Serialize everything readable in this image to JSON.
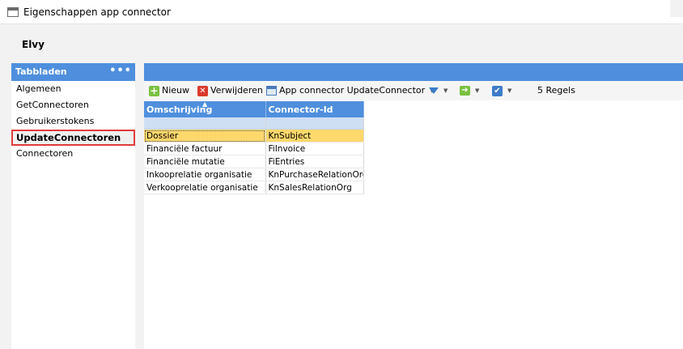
{
  "window": {
    "title": "Eigenschappen app connector"
  },
  "organization": "Elvy",
  "sidebar": {
    "header": "Tabbladen",
    "more": "•••",
    "items": [
      {
        "label": "Algemeen"
      },
      {
        "label": "GetConnectoren"
      },
      {
        "label": "Gebruikerstokens"
      },
      {
        "label": "UpdateConnectoren",
        "selected": true
      },
      {
        "label": "Connectoren"
      }
    ]
  },
  "toolbar": {
    "new_label": "Nieuw",
    "delete_label": "Verwijderen",
    "connector_label": "App connector UpdateConnector",
    "count_label": "5 Regels"
  },
  "grid": {
    "columns": [
      "Omschrijving",
      "Connector-Id"
    ],
    "rows": [
      {
        "description": "Dossier",
        "connector_id": "KnSubject",
        "selected": true
      },
      {
        "description": "Financiële factuur",
        "connector_id": "FiInvoice"
      },
      {
        "description": "Financiële mutatie",
        "connector_id": "FiEntries"
      },
      {
        "description": "Inkooprelatie organisatie",
        "connector_id": "KnPurchaseRelationOrg"
      },
      {
        "description": "Verkooprelatie organisatie",
        "connector_id": "KnSalesRelationOrg"
      }
    ]
  },
  "colors": {
    "accent": "#4f8fdd",
    "selected_row": "#ffd86b",
    "highlight_border": "#e03c3c"
  }
}
